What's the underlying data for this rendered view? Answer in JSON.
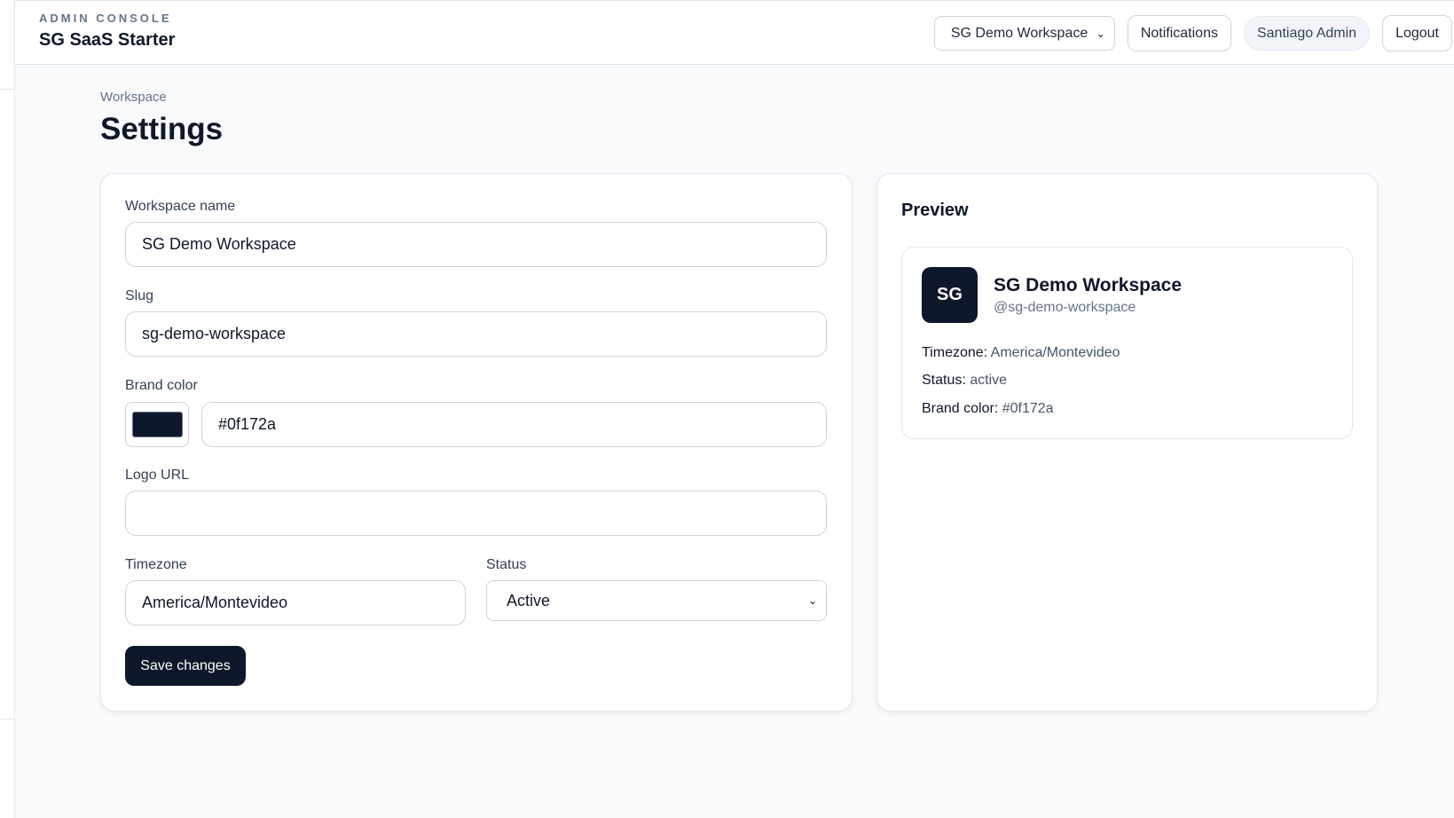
{
  "header": {
    "kicker": "ADMIN CONSOLE",
    "app_title": "SG SaaS Starter",
    "workspace_select": "SG Demo Workspace",
    "notifications_label": "Notifications",
    "user_label": "Santiago Admin",
    "logout_label": "Logout"
  },
  "page": {
    "breadcrumb": "Workspace",
    "title": "Settings"
  },
  "form": {
    "workspace_name": {
      "label": "Workspace name",
      "value": "SG Demo Workspace"
    },
    "slug": {
      "label": "Slug",
      "value": "sg-demo-workspace"
    },
    "brand_color": {
      "label": "Brand color",
      "value": "#0f172a",
      "swatch": "#0f172a"
    },
    "logo_url": {
      "label": "Logo URL",
      "value": ""
    },
    "timezone": {
      "label": "Timezone",
      "value": "America/Montevideo"
    },
    "status": {
      "label": "Status",
      "value": "Active"
    },
    "save_label": "Save changes"
  },
  "preview": {
    "heading": "Preview",
    "avatar_initials": "SG",
    "avatar_color": "#0f172a",
    "name": "SG Demo Workspace",
    "handle": "@sg-demo-workspace",
    "timezone_label": "Timezone:",
    "timezone_value": "America/Montevideo",
    "status_label": "Status:",
    "status_value": "active",
    "brand_color_label": "Brand color:",
    "brand_color_value": "#0f172a"
  },
  "icons": {
    "select_chevron": "chevron-down-icon"
  }
}
